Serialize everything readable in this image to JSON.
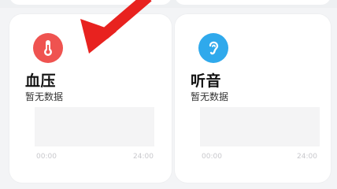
{
  "cards": [
    {
      "title": "血压",
      "subtitle": "暂无数据",
      "icon": "thermometer-icon",
      "icon_color": "#ef5350",
      "axis_start": "00:00",
      "axis_end": "24:00"
    },
    {
      "title": "听音",
      "subtitle": "暂无数据",
      "icon": "ear-icon",
      "icon_color": "#2fa9ec",
      "axis_start": "00:00",
      "axis_end": "24:00"
    }
  ],
  "annotation": {
    "arrow_color": "#e8221f"
  }
}
